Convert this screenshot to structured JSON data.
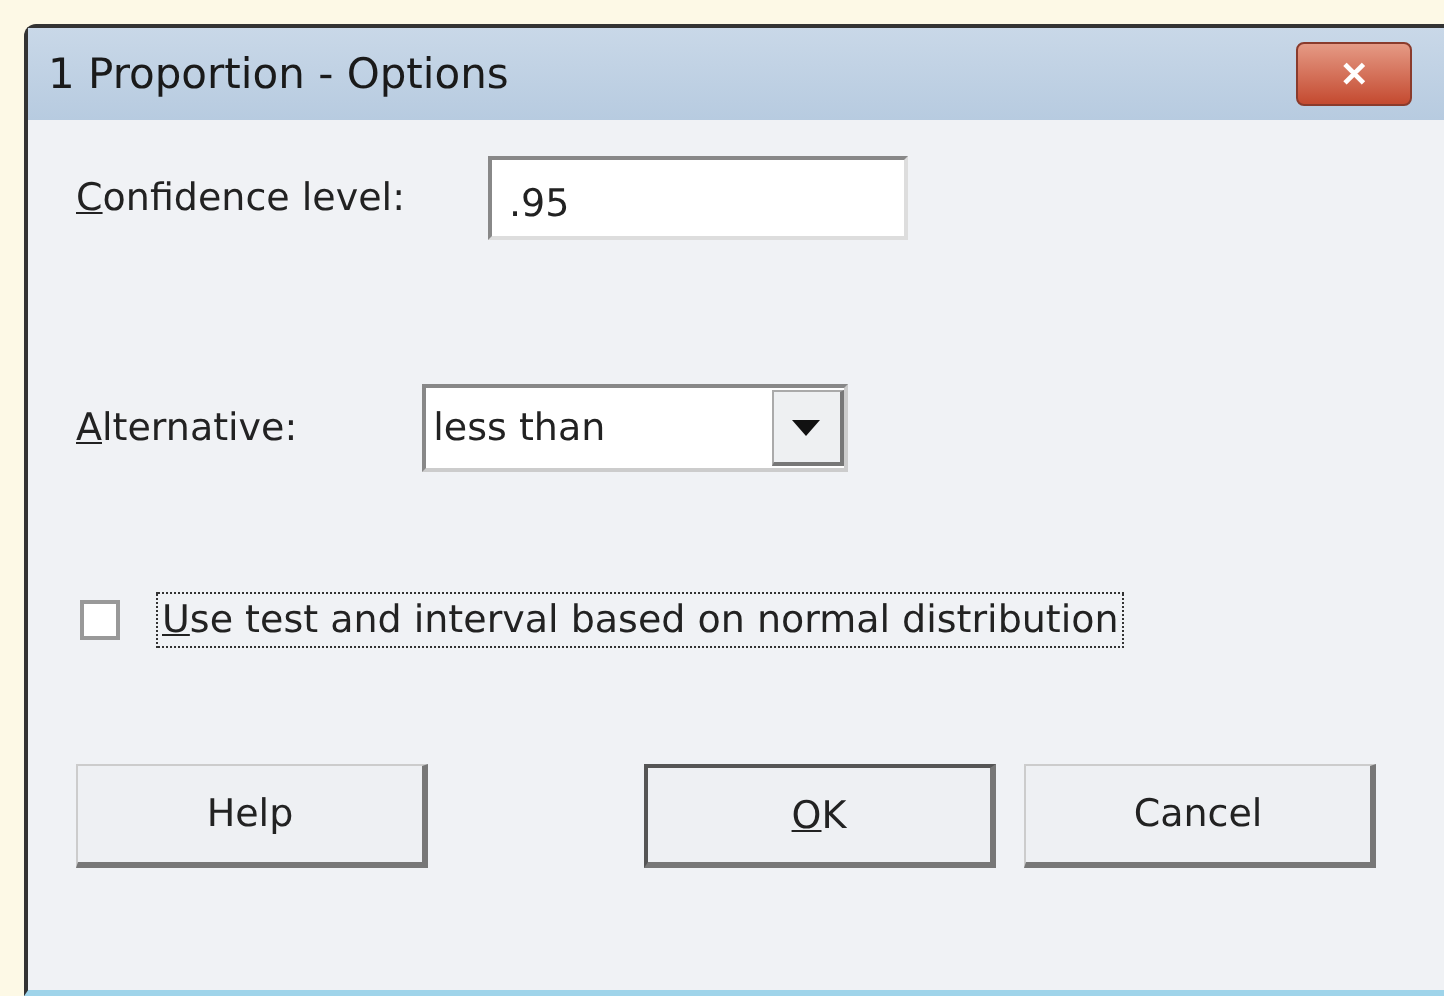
{
  "window": {
    "title": "1 Proportion - Options",
    "close": "✕"
  },
  "confidence": {
    "label": "Confidence level:",
    "underline_first": true,
    "value": ".95"
  },
  "alternative": {
    "label": "Alternative:",
    "underline_first": true,
    "value": "less than"
  },
  "normal": {
    "label": "Use test and interval based on normal distribution",
    "underline_first": true,
    "checked": false,
    "focused": true
  },
  "buttons": [
    {
      "label": "Help",
      "underline_first": false,
      "default": false
    },
    {
      "label": "OK",
      "underline_first": true,
      "default": true
    },
    {
      "label": "Cancel",
      "underline_first": false,
      "default": false
    }
  ]
}
